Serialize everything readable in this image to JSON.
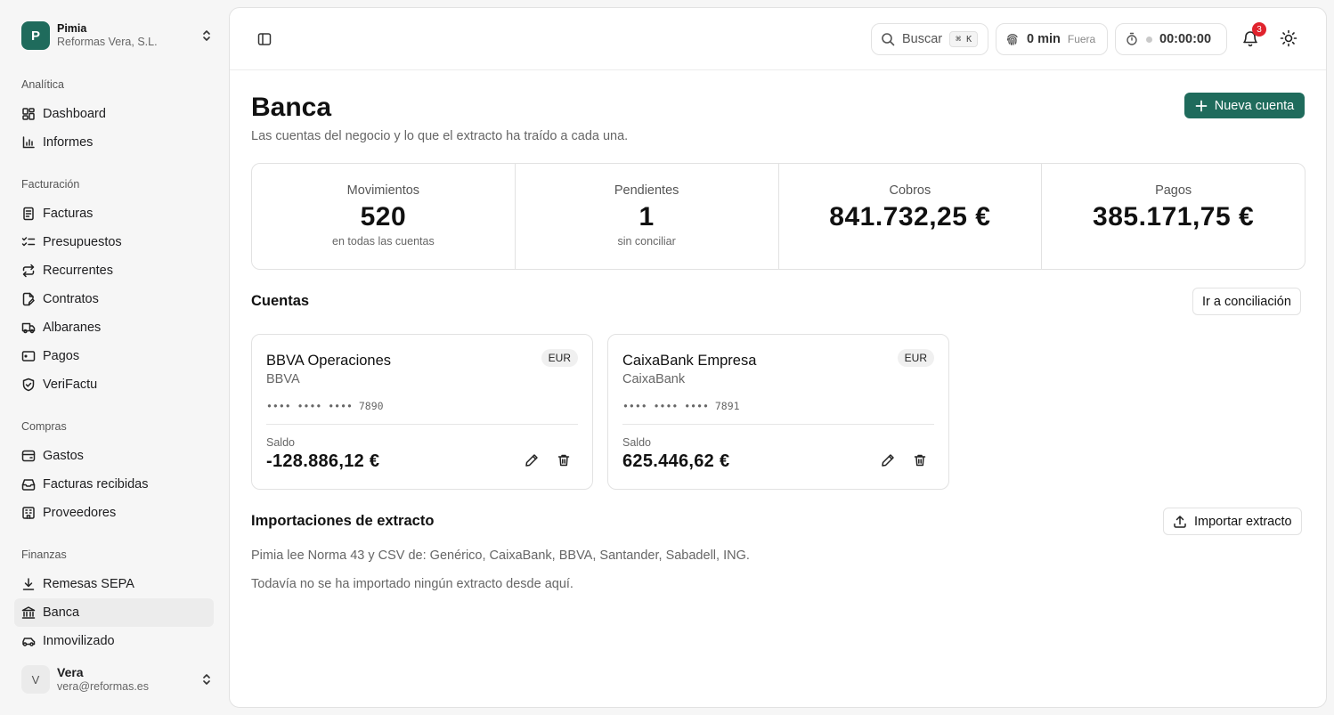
{
  "org": {
    "logo_letter": "P",
    "name": "Pimia",
    "company": "Reformas Vera, S.L."
  },
  "nav": {
    "groups": [
      {
        "label": "Analítica",
        "items": [
          {
            "label": "Dashboard"
          },
          {
            "label": "Informes"
          }
        ]
      },
      {
        "label": "Facturación",
        "items": [
          {
            "label": "Facturas"
          },
          {
            "label": "Presupuestos"
          },
          {
            "label": "Recurrentes"
          },
          {
            "label": "Contratos"
          },
          {
            "label": "Albaranes"
          },
          {
            "label": "Pagos"
          },
          {
            "label": "VeriFactu"
          }
        ]
      },
      {
        "label": "Compras",
        "items": [
          {
            "label": "Gastos"
          },
          {
            "label": "Facturas recibidas"
          },
          {
            "label": "Proveedores"
          }
        ]
      },
      {
        "label": "Finanzas",
        "items": [
          {
            "label": "Remesas SEPA"
          },
          {
            "label": "Banca"
          },
          {
            "label": "Inmovilizado"
          }
        ]
      }
    ],
    "active": "Banca"
  },
  "user": {
    "initial": "V",
    "name": "Vera",
    "email": "vera@reformas.es"
  },
  "topbar": {
    "search_label": "Buscar",
    "search_shortcut": "⌘ K",
    "time_value": "0 min",
    "time_status": "Fuera",
    "timer": "00:00:00",
    "notifications": "3"
  },
  "page": {
    "title": "Banca",
    "subtitle": "Las cuentas del negocio y lo que el extracto ha traído a cada una.",
    "new_account_label": "Nueva cuenta"
  },
  "stats": [
    {
      "label": "Movimientos",
      "value": "520",
      "hint": "en todas las cuentas"
    },
    {
      "label": "Pendientes",
      "value": "1",
      "hint": "sin conciliar"
    },
    {
      "label": "Cobros",
      "value": "841.732,25 €",
      "hint": ""
    },
    {
      "label": "Pagos",
      "value": "385.171,75 €",
      "hint": ""
    }
  ],
  "accounts_section": {
    "title": "Cuentas",
    "reconcile_label": "Ir a conciliación"
  },
  "accounts": [
    {
      "name": "BBVA Operaciones",
      "bank": "BBVA",
      "currency": "EUR",
      "iban": "•••• •••• •••• 7890",
      "balance_label": "Saldo",
      "balance": "-128.886,12 €"
    },
    {
      "name": "CaixaBank Empresa",
      "bank": "CaixaBank",
      "currency": "EUR",
      "iban": "•••• •••• •••• 7891",
      "balance_label": "Saldo",
      "balance": "625.446,62 €"
    }
  ],
  "imports": {
    "title": "Importaciones de extracto",
    "import_label": "Importar extracto",
    "formats_text": "Pimia lee Norma 43 y CSV de: Genérico, CaixaBank, BBVA, Santander, Sabadell, ING.",
    "empty_text": "Todavía no se ha importado ningún extracto desde aquí."
  },
  "colors": {
    "brand": "#1f6b5c",
    "badge": "#e0232d"
  }
}
